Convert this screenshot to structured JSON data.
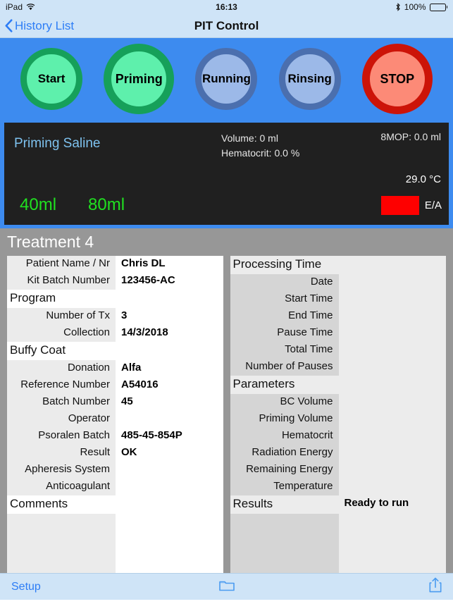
{
  "statusbar": {
    "device": "iPad",
    "wifi_icon": "wifi-icon",
    "time": "16:13",
    "bluetooth_icon": "bluetooth-icon",
    "battery_percent": "100%",
    "battery_icon": "battery-full-icon"
  },
  "navbar": {
    "back_icon": "chevron-left-icon",
    "back_label": "History List",
    "title": "PIT Control"
  },
  "phase_buttons": [
    {
      "label": "Start",
      "state": "active",
      "fill": "#5ef0ac",
      "ring": "#16a05a"
    },
    {
      "label": "Priming",
      "state": "active",
      "fill": "#5ef0ac",
      "ring": "#16a05a"
    },
    {
      "label": "Running",
      "state": "inactive",
      "fill": "#9cb9e8",
      "ring": "#4b6fae"
    },
    {
      "label": "Rinsing",
      "state": "inactive",
      "fill": "#9cb9e8",
      "ring": "#4b6fae"
    },
    {
      "label": "STOP",
      "state": "stop",
      "fill": "#fc8a77",
      "ring": "#cc1408"
    }
  ],
  "status_panel": {
    "phase_title": "Priming Saline",
    "volume": "Volume: 0 ml",
    "hematocrit": "Hematocrit: 0.0 %",
    "mop": "8MOP: 0.0 ml",
    "temperature": "29.0 °C",
    "volume_button_1": "40ml",
    "volume_button_2": "80ml",
    "ea_label": "E/A",
    "ea_color": "#fe0000",
    "background": "#202020",
    "accent_green": "#20e020",
    "title_blue": "#7ec2ef"
  },
  "treatment": {
    "header": "Treatment 4"
  },
  "left_panel": {
    "rows": [
      {
        "kind": "row",
        "label": "Patient Name / Nr",
        "value": "Chris DL"
      },
      {
        "kind": "row",
        "label": "Kit Batch Number",
        "value": "123456-AC"
      },
      {
        "kind": "sect",
        "label": "Program",
        "value": ""
      },
      {
        "kind": "row",
        "label": "Number of Tx",
        "value": "3"
      },
      {
        "kind": "row",
        "label": "Collection",
        "value": "14/3/2018"
      },
      {
        "kind": "sect",
        "label": "Buffy Coat",
        "value": ""
      },
      {
        "kind": "row",
        "label": "Donation",
        "value": "Alfa"
      },
      {
        "kind": "row",
        "label": "Reference Number",
        "value": "A54016"
      },
      {
        "kind": "row",
        "label": "Batch Number",
        "value": "45"
      },
      {
        "kind": "row",
        "label": "Operator",
        "value": ""
      },
      {
        "kind": "row",
        "label": "Psoralen Batch",
        "value": "485-45-854P"
      },
      {
        "kind": "row",
        "label": "Result",
        "value": "OK"
      },
      {
        "kind": "row",
        "label": "Apheresis System",
        "value": ""
      },
      {
        "kind": "row",
        "label": "Anticoagulant",
        "value": ""
      },
      {
        "kind": "sect",
        "label": "Comments",
        "value": ""
      }
    ]
  },
  "right_panel": {
    "rows": [
      {
        "kind": "sect",
        "label": "Processing Time",
        "value": ""
      },
      {
        "kind": "row",
        "label": "Date",
        "value": ""
      },
      {
        "kind": "row",
        "label": "Start Time",
        "value": ""
      },
      {
        "kind": "row",
        "label": "End Time",
        "value": ""
      },
      {
        "kind": "row",
        "label": "Pause Time",
        "value": ""
      },
      {
        "kind": "row",
        "label": "Total Time",
        "value": ""
      },
      {
        "kind": "row",
        "label": "Number of Pauses",
        "value": ""
      },
      {
        "kind": "sect",
        "label": "Parameters",
        "value": ""
      },
      {
        "kind": "row",
        "label": "BC Volume",
        "value": ""
      },
      {
        "kind": "row",
        "label": "Priming Volume",
        "value": ""
      },
      {
        "kind": "row",
        "label": "Hematocrit",
        "value": ""
      },
      {
        "kind": "row",
        "label": "Radiation Energy",
        "value": ""
      },
      {
        "kind": "row",
        "label": "Remaining Energy",
        "value": ""
      },
      {
        "kind": "row",
        "label": "Temperature",
        "value": ""
      },
      {
        "kind": "sect",
        "label": "Results",
        "value": "Ready to run"
      }
    ]
  },
  "toolbar": {
    "setup_label": "Setup",
    "folder_icon": "folder-icon",
    "share_icon": "share-icon",
    "tint": "#2d7df6"
  }
}
